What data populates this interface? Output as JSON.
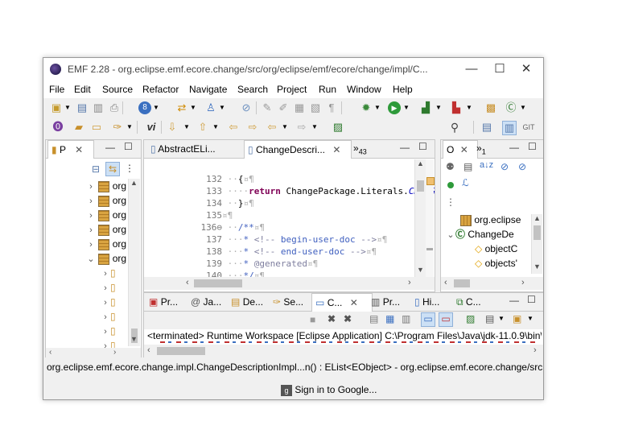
{
  "window": {
    "title": "EMF 2.28 - org.eclipse.emf.ecore.change/src/org/eclipse/emf/ecore/change/impl/C...",
    "minimize": "—",
    "maximize": "☐",
    "close": "✕"
  },
  "menu": [
    "File",
    "Edit",
    "Source",
    "Refactor",
    "Navigate",
    "Search",
    "Project",
    "Run",
    "Window",
    "Help"
  ],
  "package_explorer": {
    "tab_label": "P",
    "items": [
      {
        "label": "org",
        "expanded": false
      },
      {
        "label": "org",
        "expanded": false
      },
      {
        "label": "org",
        "expanded": false
      },
      {
        "label": "org",
        "expanded": false
      },
      {
        "label": "org",
        "expanded": false
      },
      {
        "label": "org",
        "expanded": true
      }
    ]
  },
  "editor": {
    "tabs": [
      {
        "label": "AbstractELi...",
        "active": false
      },
      {
        "label": "ChangeDescri...",
        "active": true
      }
    ],
    "overflow": "»",
    "overflow_count": "43",
    "lines": [
      {
        "n": "132",
        "ws": " ··",
        "text": "{",
        "ws2": "¤¶"
      },
      {
        "n": "133",
        "ws": " ····",
        "kw": "return",
        "text": " ChangePackage.Literals.",
        "ital": "CHANGE_"
      },
      {
        "n": "134",
        "ws": " ··",
        "text": "}",
        "ws2": "¤¶"
      },
      {
        "n": "135",
        "ws": "",
        "text": "",
        "ws2": "¤¶"
      },
      {
        "n": "136⊖",
        "ws": " ··",
        "cm": "/**",
        "ws2": "¤¶"
      },
      {
        "n": "137",
        "ws": " ···",
        "cm": "* ",
        "tag": "<!-- ",
        "cm2": "begin-user-doc",
        "tag2": " -->",
        "ws2": "¤¶"
      },
      {
        "n": "138",
        "ws": " ···",
        "cm": "* ",
        "tag": "<!-- ",
        "cm2": "end-user-doc",
        "tag2": " -->",
        "ws2": "¤¶"
      },
      {
        "n": "139",
        "ws": " ···",
        "cm": "* ",
        "tag": "@generated",
        "ws2": "¤¶"
      },
      {
        "n": "140",
        "ws": " ···",
        "cm": "*/",
        "ws2": "¤¶"
      }
    ]
  },
  "outline": {
    "tab_label": "O",
    "overflow": "»",
    "overflow_count": "1",
    "items": [
      {
        "label": "org.eclipse",
        "level": 0
      },
      {
        "label": "ChangeDe",
        "level": 0
      },
      {
        "label": "objectC",
        "level": 1
      },
      {
        "label": "objects'",
        "level": 1
      }
    ]
  },
  "bottom": {
    "tabs": [
      {
        "label": "Pr..."
      },
      {
        "label": "Ja..."
      },
      {
        "label": "De..."
      },
      {
        "label": "Se..."
      },
      {
        "label": "C...",
        "active": true
      },
      {
        "label": "Pr..."
      },
      {
        "label": "Hi..."
      },
      {
        "label": "C..."
      }
    ],
    "console_text": "<terminated> Runtime Workspace [Eclipse Application] C:\\Program Files\\Java\\jdk-11.0.9\\bin\\"
  },
  "status": {
    "text": "org.eclipse.emf.ecore.change.impl.ChangeDescriptionImpl...n() : EList<EObject> - org.eclipse.emf.ecore.change/src",
    "signin": "Sign in to Google..."
  }
}
